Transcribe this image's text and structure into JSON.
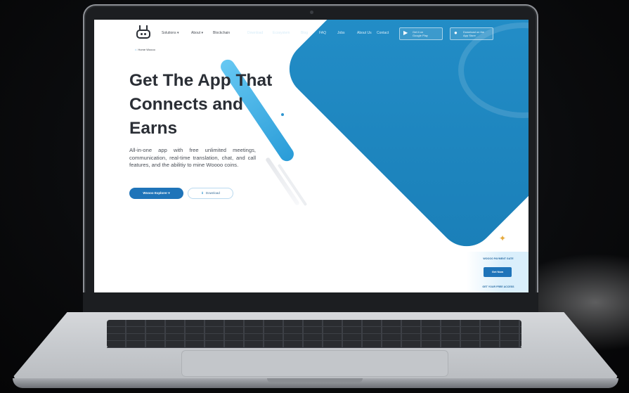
{
  "site": {
    "nav": {
      "items": [
        "Solutions",
        "About",
        "Blockchain",
        "Download",
        "Ecosystem",
        "Blog",
        "FAQ",
        "Jobs",
        "About Us",
        "Contact"
      ],
      "store_buttons": [
        {
          "label_top": "Get it on",
          "label_main": "Google Play",
          "icon": "play-icon"
        },
        {
          "label_top": "Download on the",
          "label_main": "App Store",
          "icon": "apple-icon"
        }
      ]
    },
    "breadcrumb": "Home Woooo",
    "hero": {
      "title_line1": "Get The App That",
      "title_line2": "Connects and",
      "title_line3": "Earns",
      "description": "All-in-one app with free unlimited meetings, communication, real-time translation, chat, and call features, and the abilitiy to mine Woooo coins.",
      "primary_button": "Woooo Explorer",
      "download_button": "Download"
    },
    "promo": {
      "title": "WOOOO PAYMENT GATE",
      "button": "Get Now",
      "subtitle": "GET YOUR FREE ACCESS"
    },
    "colors": {
      "brand_blue": "#1f88c3",
      "button_blue": "#1f74b9",
      "heading": "#2a2e35"
    }
  }
}
